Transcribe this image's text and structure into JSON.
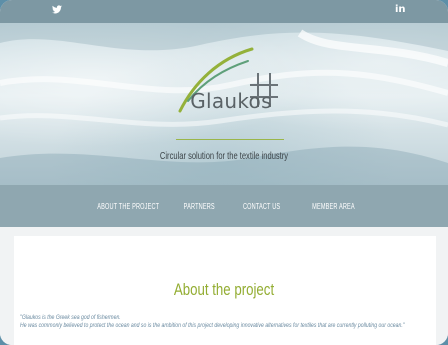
{
  "social": {
    "twitter": "🐦",
    "linkedin": "in"
  },
  "brand": {
    "name": "Glaukos",
    "tagline": "Circular solution for the textile industry",
    "accent": "#93ad32",
    "primary": "#8fa7b0"
  },
  "nav": {
    "items": [
      {
        "label": "ABOUT THE PROJECT"
      },
      {
        "label": "PARTNERS"
      },
      {
        "label": "CONTACT US"
      },
      {
        "label": "MEMBER AREA"
      }
    ]
  },
  "about": {
    "title": "About the project",
    "quote_line1": "\"Glaukos is the Greek sea god of fishermen.",
    "quote_line2": "He was commonly believed to protect the ocean and so is the ambition of this project developing innovative alternatives for textiles that are currently polluting our ocean.\""
  }
}
